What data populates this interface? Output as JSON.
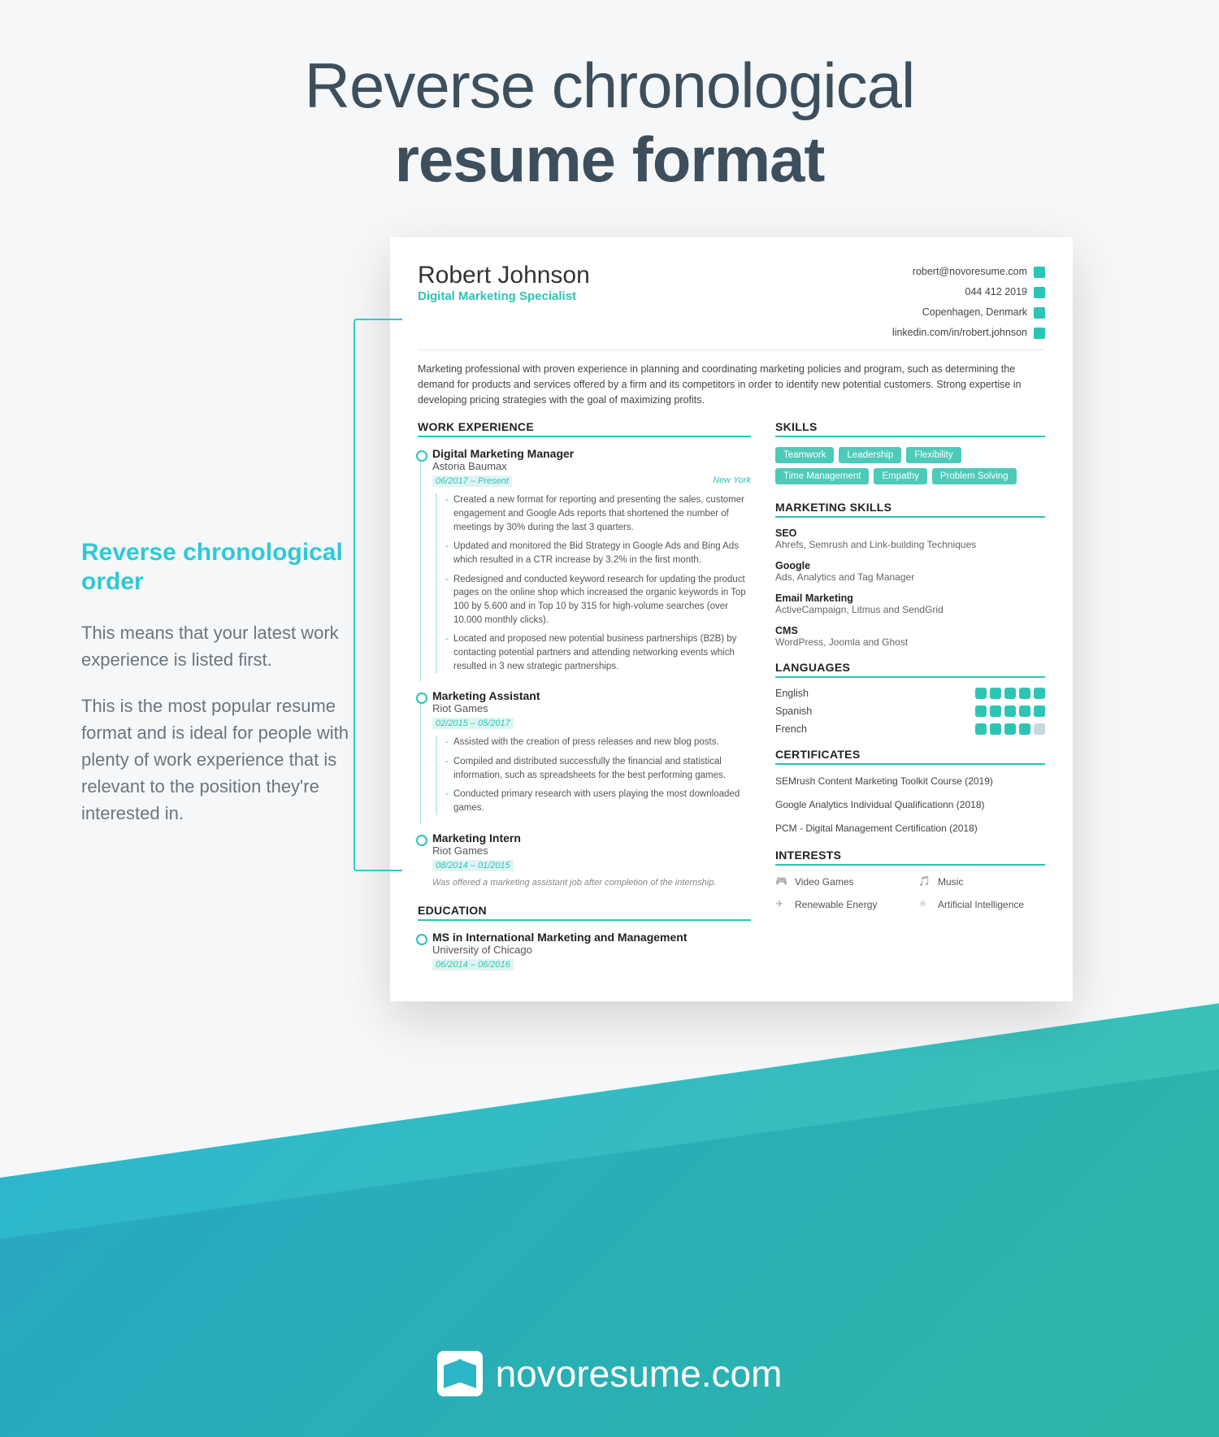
{
  "header": {
    "line1": "Reverse chronological",
    "line2": "resume format"
  },
  "side": {
    "title": "Reverse chronological order",
    "p1": "This means that your latest work experience is listed first.",
    "p2": "This is the most popular resume format and is ideal for people with plenty of work experience that is relevant to the position they're interested in."
  },
  "resume": {
    "name": "Robert Johnson",
    "role": "Digital Marketing Specialist",
    "contact": {
      "email": "robert@novoresume.com",
      "phone": "044 412 2019",
      "location": "Copenhagen, Denmark",
      "linkedin": "linkedin.com/in/robert.johnson"
    },
    "summary": "Marketing professional with proven experience in planning and coordinating marketing policies and program, such as determining the demand for products and services offered by a firm and its competitors in order to identify new potential customers. Strong expertise in developing pricing strategies with the goal of maximizing profits.",
    "sections": {
      "work": "WORK EXPERIENCE",
      "education": "EDUCATION",
      "skills": "SKILLS",
      "mskills": "MARKETING SKILLS",
      "languages": "LANGUAGES",
      "certs": "CERTIFICATES",
      "interests": "INTERESTS"
    },
    "jobs": [
      {
        "title": "Digital Marketing Manager",
        "company": "Astoria Baumax",
        "dates": "06/2017 – Present",
        "loc": "New York",
        "bullets": [
          "Created a new format for reporting and presenting the sales, customer engagement and Google Ads reports that shortened the number of meetings by 30% during the last 3 quarters.",
          "Updated and monitored the Bid Strategy in Google Ads and Bing Ads which resulted in a CTR increase by 3.2% in the first month.",
          "Redesigned and conducted keyword research for updating the product pages on the online shop which increased the organic keywords in Top 100 by 5.600 and in Top 10 by 315 for high-volume searches (over 10.000 monthly clicks).",
          "Located and proposed new potential business partnerships (B2B) by contacting potential partners and attending networking events which resulted in 3 new strategic partnerships."
        ]
      },
      {
        "title": "Marketing Assistant",
        "company": "Riot Games",
        "dates": "02/2015 – 05/2017",
        "loc": "",
        "bullets": [
          "Assisted with the creation of press releases and new blog posts.",
          "Compiled and distributed successfully the financial and statistical information, such as spreadsheets for the best performing games.",
          "Conducted primary research with users playing the most downloaded games."
        ]
      },
      {
        "title": "Marketing Intern",
        "company": "Riot Games",
        "dates": "08/2014 – 01/2015",
        "loc": "",
        "note": "Was offered a marketing assistant job after completion of the internship."
      }
    ],
    "education": {
      "degree": "MS in International Marketing and Management",
      "school": "University of Chicago",
      "dates": "06/2014 – 06/2016"
    },
    "soft_skills": [
      "Teamwork",
      "Leadership",
      "Flexibility",
      "Time Management",
      "Empathy",
      "Problem Solving"
    ],
    "mskills": [
      {
        "name": "SEO",
        "desc": "Ahrefs, Semrush and Link-building Techniques"
      },
      {
        "name": "Google",
        "desc": "Ads, Analytics and Tag Manager"
      },
      {
        "name": "Email Marketing",
        "desc": "ActiveCampaign, Litmus and SendGrid"
      },
      {
        "name": "CMS",
        "desc": "WordPress, Joomla and Ghost"
      }
    ],
    "languages": [
      {
        "name": "English",
        "level": 5
      },
      {
        "name": "Spanish",
        "level": 5
      },
      {
        "name": "French",
        "level": 4
      }
    ],
    "certs": [
      "SEMrush Content Marketing Toolkit Course (2019)",
      "Google Analytics Individual Qualificationn (2018)",
      "PCM - Digital Management Certification (2018)"
    ],
    "interests": [
      "Video Games",
      "Music",
      "Renewable Energy",
      "Artificial Intelligence"
    ]
  },
  "footer": "novoresume.com"
}
